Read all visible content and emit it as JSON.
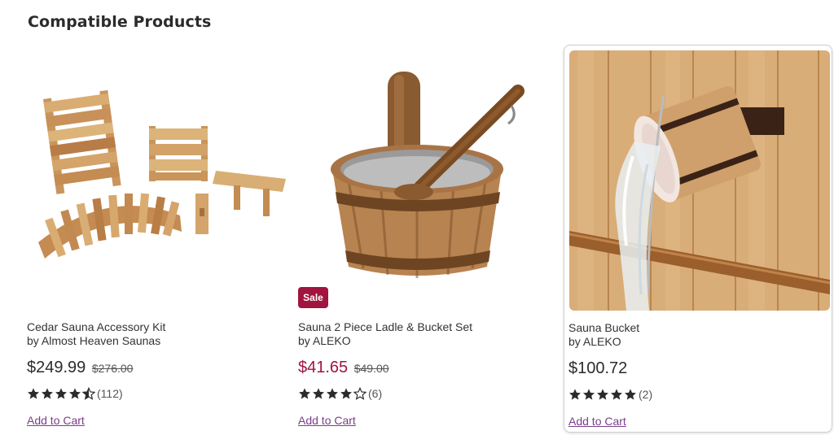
{
  "section": {
    "title": "Compatible Products"
  },
  "products": [
    {
      "name": "Cedar Sauna Accessory Kit",
      "brand": "by Almost Heaven Saunas",
      "price": "$249.99",
      "original_price": "$276.00",
      "rating": 4.5,
      "review_count": "(112)",
      "cart_label": "Add to Cart",
      "image_icon": "sauna-accessory-kit-image"
    },
    {
      "name": "Sauna 2 Piece Ladle & Bucket Set",
      "brand": "by ALEKO",
      "price": "$41.65",
      "original_price": "$49.00",
      "sale_badge": "Sale",
      "rating": 4,
      "review_count": "(6)",
      "cart_label": "Add to Cart",
      "image_icon": "ladle-bucket-image"
    },
    {
      "name": "Sauna Bucket",
      "brand": "by ALEKO",
      "price": "$100.72",
      "rating": 5,
      "review_count": "(2)",
      "cart_label": "Add to Cart",
      "image_icon": "sauna-bucket-image"
    }
  ],
  "colors": {
    "sale": "#a1143f",
    "link": "#7a3e8a",
    "star": "#2b2b2b"
  }
}
